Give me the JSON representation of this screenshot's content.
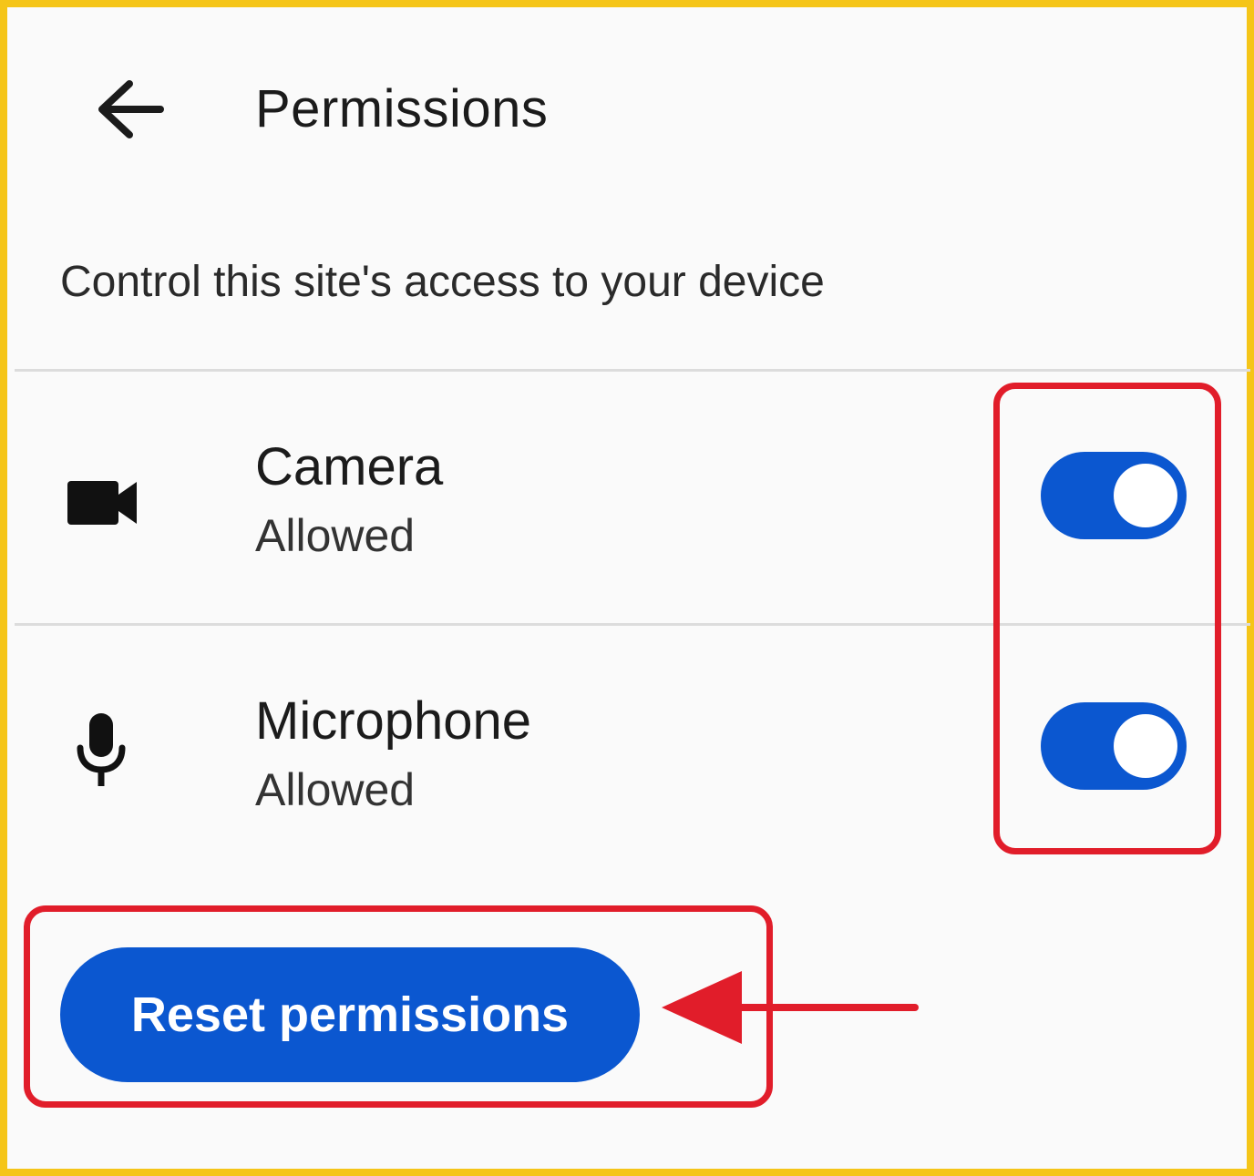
{
  "header": {
    "back_icon": "arrow-back-icon",
    "title": "Permissions"
  },
  "subtitle": "Control this site's access to your device",
  "permissions": [
    {
      "icon": "videocam-icon",
      "name": "Camera",
      "status": "Allowed",
      "enabled": true
    },
    {
      "icon": "mic-icon",
      "name": "Microphone",
      "status": "Allowed",
      "enabled": true
    }
  ],
  "reset_button": {
    "label": "Reset permissions"
  },
  "colors": {
    "frame_border": "#f5c518",
    "accent_blue": "#0b57d0",
    "highlight_red": "#e11d2a",
    "background": "#fafafa"
  }
}
